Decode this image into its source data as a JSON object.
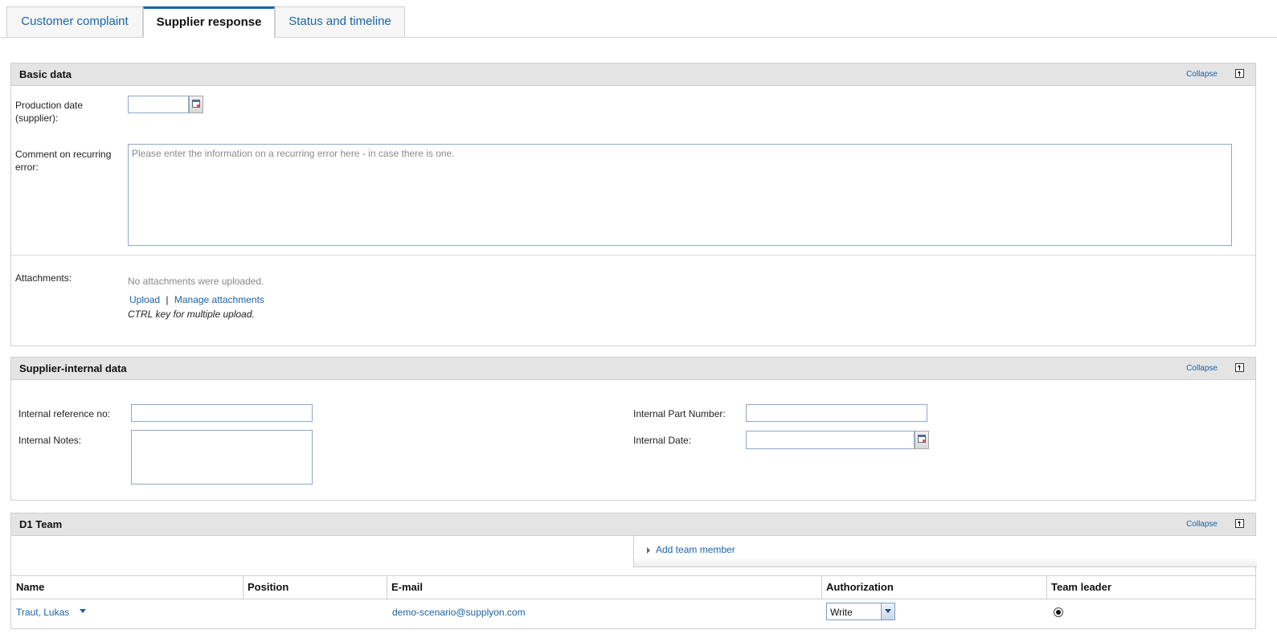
{
  "tabs": [
    {
      "label": "Customer complaint"
    },
    {
      "label": "Supplier response"
    },
    {
      "label": "Status and timeline"
    }
  ],
  "common": {
    "collapse_label": "Collapse"
  },
  "basic_data": {
    "title": "Basic data",
    "production_date_label": "Production date (supplier):",
    "production_date_value": "",
    "comment_label": "Comment on recurring error:",
    "comment_placeholder": "Please enter the information on a recurring error here - in case there is one.",
    "attachments_label": "Attachments:",
    "no_attachments": "No attachments were uploaded.",
    "upload_link": "Upload",
    "separator": "|",
    "manage_link": "Manage attachments",
    "ctrl_hint": "CTRL key for multiple upload."
  },
  "supplier_internal": {
    "title": "Supplier-internal data",
    "ref_no_label": "Internal reference no:",
    "ref_no_value": "",
    "notes_label": "Internal Notes:",
    "notes_value": "",
    "part_number_label": "Internal Part Number:",
    "part_number_value": "",
    "date_label": "Internal Date:",
    "date_value": ""
  },
  "d1_team": {
    "title": "D1 Team",
    "add_member_label": "Add team member",
    "columns": [
      "Name",
      "Position",
      "E-mail",
      "Authorization",
      "Team leader"
    ],
    "rows": [
      {
        "name": "Traut, Lukas",
        "position": "",
        "email": "demo-scenario@supplyon.com",
        "authorization": "Write",
        "team_leader": true
      }
    ]
  }
}
